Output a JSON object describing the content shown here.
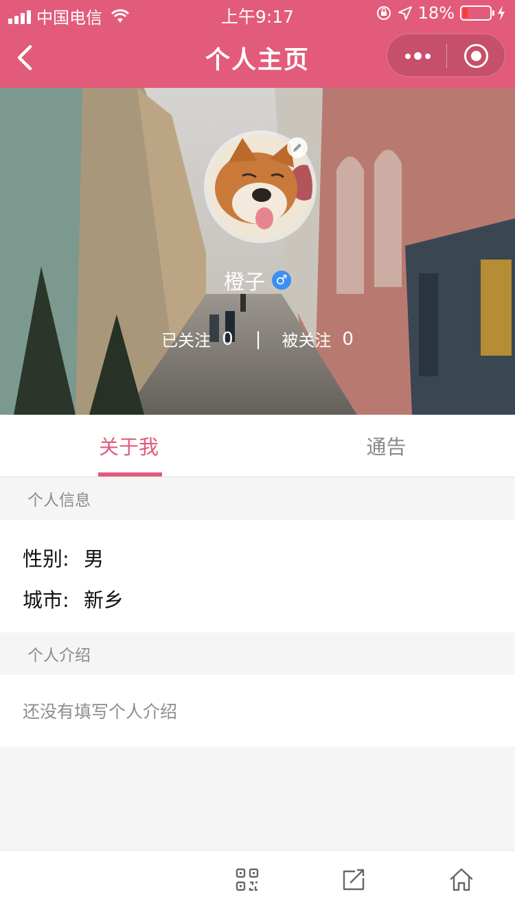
{
  "status_bar": {
    "carrier": "中国电信",
    "time": "上午9:17",
    "battery_percent": "18%",
    "battery_level": 0.18,
    "icons": [
      "signal-icon",
      "wifi-icon",
      "orientation-lock-icon",
      "location-icon",
      "battery-icon",
      "charging-icon"
    ]
  },
  "nav": {
    "title": "个人主页",
    "back_icon": "chevron-left-icon",
    "more_icon": "more-dots-icon",
    "close_icon": "miniprogram-close-icon"
  },
  "profile": {
    "name": "橙子",
    "gender_symbol": "♂",
    "following_label": "已关注",
    "following_count": "0",
    "separator": "|",
    "followers_label": "被关注",
    "followers_count": "0"
  },
  "tabs": [
    {
      "label": "关于我",
      "active": true
    },
    {
      "label": "通告",
      "active": false
    }
  ],
  "personal_info": {
    "header": "个人信息",
    "gender_label": "性别:",
    "gender_value": "男",
    "city_label": "城市:",
    "city_value": "新乡"
  },
  "introduction": {
    "header": "个人介绍",
    "placeholder_text": "还没有填写个人介绍"
  },
  "bottom_bar": {
    "icons": [
      "qr-code-icon",
      "share-icon",
      "home-icon"
    ]
  },
  "colors": {
    "brand": "#e25b7b",
    "gender_badge": "#3b8ff2",
    "background": "#f6f5f6"
  }
}
